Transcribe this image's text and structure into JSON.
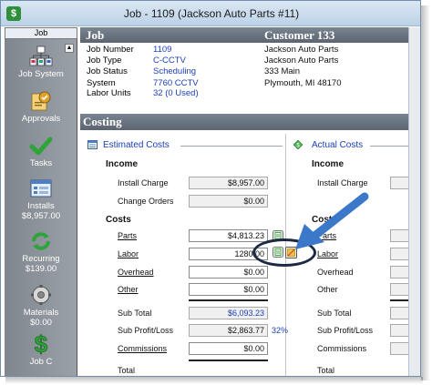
{
  "window": {
    "title": "Job - 1109 (Jackson Auto Parts #11)",
    "app_icon": "$"
  },
  "sidebar": {
    "header": "Job",
    "scroll_glyph": "▲",
    "items": [
      {
        "label": "Job System",
        "sub": "",
        "icon": "job-system-icon"
      },
      {
        "label": "Approvals",
        "sub": "",
        "icon": "approvals-icon"
      },
      {
        "label": "Tasks",
        "sub": "",
        "icon": "tasks-icon"
      },
      {
        "label": "Installs",
        "sub": "$8,957.00",
        "icon": "installs-icon"
      },
      {
        "label": "Recurring",
        "sub": "$139.00",
        "icon": "recurring-icon"
      },
      {
        "label": "Materials",
        "sub": "$0.00",
        "icon": "materials-icon"
      },
      {
        "label": "Job C",
        "sub": "",
        "icon": "job-costing-icon"
      }
    ]
  },
  "job": {
    "header": "Job",
    "fields": [
      {
        "label": "Job Number",
        "value": "1109"
      },
      {
        "label": "Job Type",
        "value": "C-CCTV"
      },
      {
        "label": "Job Status",
        "value": "Scheduling"
      },
      {
        "label": "System",
        "value": "7760 CCTV"
      },
      {
        "label": "Labor Units",
        "value": "32 (0 Used)"
      }
    ]
  },
  "customer": {
    "header": "Customer 133",
    "lines": [
      "Jackson Auto Parts",
      "Jackson Auto Parts",
      "333 Main",
      "Plymouth, MI  48170"
    ]
  },
  "costing": {
    "header": "Costing",
    "estimated": {
      "title": "Estimated Costs",
      "income_label": "Income",
      "install_charge_label": "Install Charge",
      "install_charge": "$8,957.00",
      "change_orders_label": "Change Orders",
      "change_orders": "$0.00",
      "costs_label": "Costs",
      "parts_label": "Parts",
      "parts": "$4,813.23",
      "labor_label": "Labor",
      "labor": "1280.00",
      "overhead_label": "Overhead",
      "overhead": "$0.00",
      "other_label": "Other",
      "other": "$0.00",
      "subtotal_label": "Sub Total",
      "subtotal": "$6,093.23",
      "sub_profit_label": "Sub Profit/Loss",
      "sub_profit": "$2,863.77",
      "sub_profit_pct": "32%",
      "commissions_label": "Commissions",
      "commissions": "$0.00",
      "total_label": "Total"
    },
    "actual": {
      "title": "Actual Costs",
      "income_label": "Income",
      "install_charge_label": "Install Charge",
      "costs_label": "Costs",
      "parts_label": "Parts",
      "labor_label": "Labor",
      "overhead_label": "Overhead",
      "other_label": "Other",
      "subtotal_label": "Sub Total",
      "sub_profit_label": "Sub Profit/Loss",
      "commissions_label": "Commissions",
      "total_label": "Total"
    }
  },
  "colors": {
    "accent": "#1a3fb8",
    "header_bg": "#6b7581",
    "callout_arrow": "#3b78c9"
  }
}
